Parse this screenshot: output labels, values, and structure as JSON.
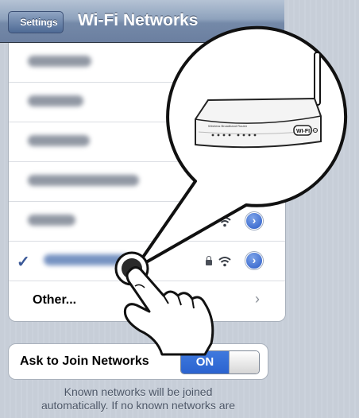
{
  "nav": {
    "back_label": "Settings",
    "title": "Wi-Fi Networks"
  },
  "networks": {
    "other_label": "Other..."
  },
  "join": {
    "label": "Ask to Join Networks",
    "toggle_state": "ON"
  },
  "footer": {
    "line1": "Known networks will be joined",
    "line2": "automatically.  If no known networks are"
  },
  "router": {
    "caption": "Wireless Broadband Router",
    "badge": "WI-FI"
  },
  "colors": {
    "navbar": "#7489a8",
    "accent_blue": "#2b63cf",
    "checkmark": "#3b5998"
  }
}
